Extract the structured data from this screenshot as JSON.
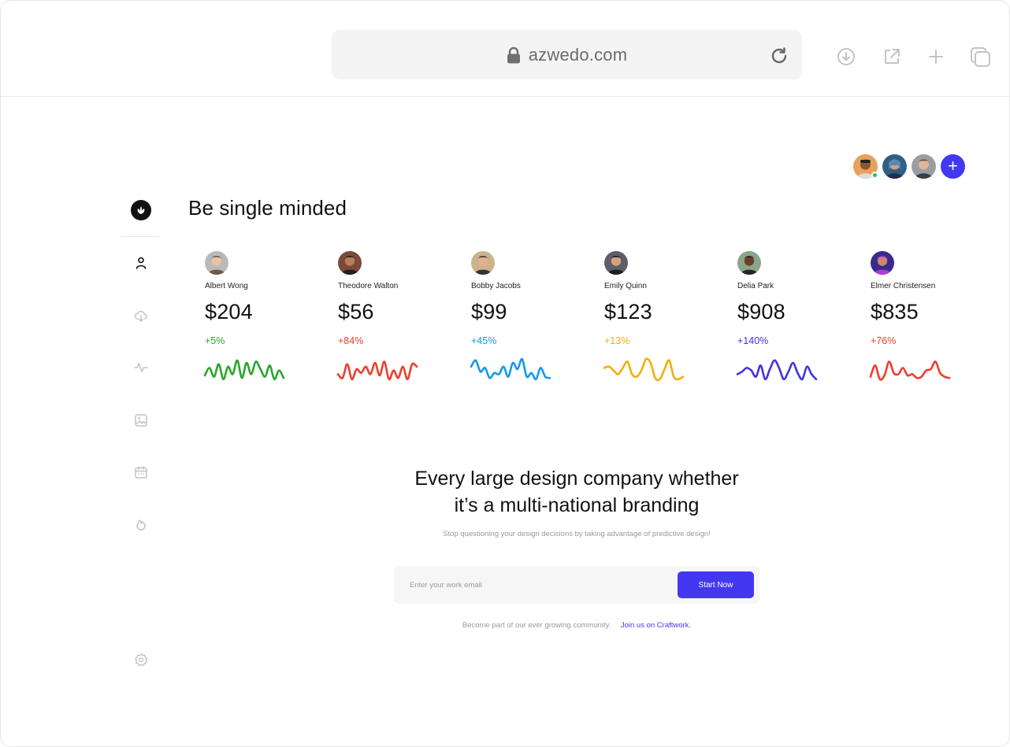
{
  "browser": {
    "url": "azwedo.com",
    "icons": [
      "lock-icon",
      "reload-icon",
      "download-icon",
      "external-link-icon",
      "plus-icon",
      "copy-icon"
    ]
  },
  "sidebar": {
    "logo": "leaf-logo-icon",
    "items": [
      "user-icon",
      "cloud-download-icon",
      "activity-icon",
      "image-icon",
      "calendar-icon",
      "fire-icon"
    ],
    "bottom": "settings-icon"
  },
  "header": {
    "title": "Be single minded",
    "add_label": "+"
  },
  "colors": {
    "accent": "#4437f2",
    "online": "#22c55e"
  },
  "users": [
    {
      "name": "Albert Wong",
      "amount": "$204",
      "change": "+5%",
      "color": "#2aa52a",
      "trend": [
        0.25,
        0.55,
        0.2,
        0.7,
        0.1,
        0.6,
        0.3,
        0.85,
        0.15,
        0.75,
        0.3,
        0.8,
        0.5,
        0.2,
        0.65,
        0.1,
        0.45,
        0.15
      ]
    },
    {
      "name": "Theodore Walton",
      "amount": "$56",
      "change": "+84%",
      "color": "#f03d2c",
      "trend": [
        0.3,
        0.15,
        0.7,
        0.1,
        0.5,
        0.35,
        0.6,
        0.3,
        0.75,
        0.25,
        0.8,
        0.1,
        0.45,
        0.15,
        0.6,
        0.1,
        0.7,
        0.6
      ]
    },
    {
      "name": "Bobby Jacobs",
      "amount": "$99",
      "change": "+45%",
      "color": "#1598ec",
      "trend": [
        0.6,
        0.85,
        0.4,
        0.55,
        0.15,
        0.35,
        0.3,
        0.6,
        0.2,
        0.75,
        0.5,
        0.9,
        0.2,
        0.35,
        0.1,
        0.55,
        0.2,
        0.15
      ]
    },
    {
      "name": "Emily Quinn",
      "amount": "$123",
      "change": "+13%",
      "color": "#f5ad0a",
      "trend": [
        0.55,
        0.6,
        0.45,
        0.3,
        0.55,
        0.8,
        0.3,
        0.2,
        0.45,
        0.9,
        0.75,
        0.15,
        0.1,
        0.5,
        0.85,
        0.2,
        0.1,
        0.2
      ]
    },
    {
      "name": "Delia Park",
      "amount": "$908",
      "change": "+140%",
      "color": "#4132e6",
      "trend": [
        0.3,
        0.4,
        0.55,
        0.45,
        0.2,
        0.65,
        0.1,
        0.5,
        0.85,
        0.55,
        0.1,
        0.4,
        0.75,
        0.35,
        0.1,
        0.6,
        0.3,
        0.1
      ]
    },
    {
      "name": "Elmer Christensen",
      "amount": "$835",
      "change": "+76%",
      "color": "#f03d2c",
      "trend": [
        0.2,
        0.65,
        0.1,
        0.25,
        0.8,
        0.35,
        0.3,
        0.55,
        0.25,
        0.3,
        0.15,
        0.2,
        0.45,
        0.5,
        0.8,
        0.35,
        0.2,
        0.15
      ]
    }
  ],
  "hero": {
    "title_line1": "Every large design company whether",
    "title_line2": "it’s a multi-national branding",
    "subtitle": "Stop questioning your design decisions by taking advantage of predictive design!"
  },
  "signup": {
    "placeholder": "Enter your work email",
    "button": "Start Now"
  },
  "community": {
    "text": "Become part of our ever growing community.",
    "link": "Join us on Craftwork."
  }
}
